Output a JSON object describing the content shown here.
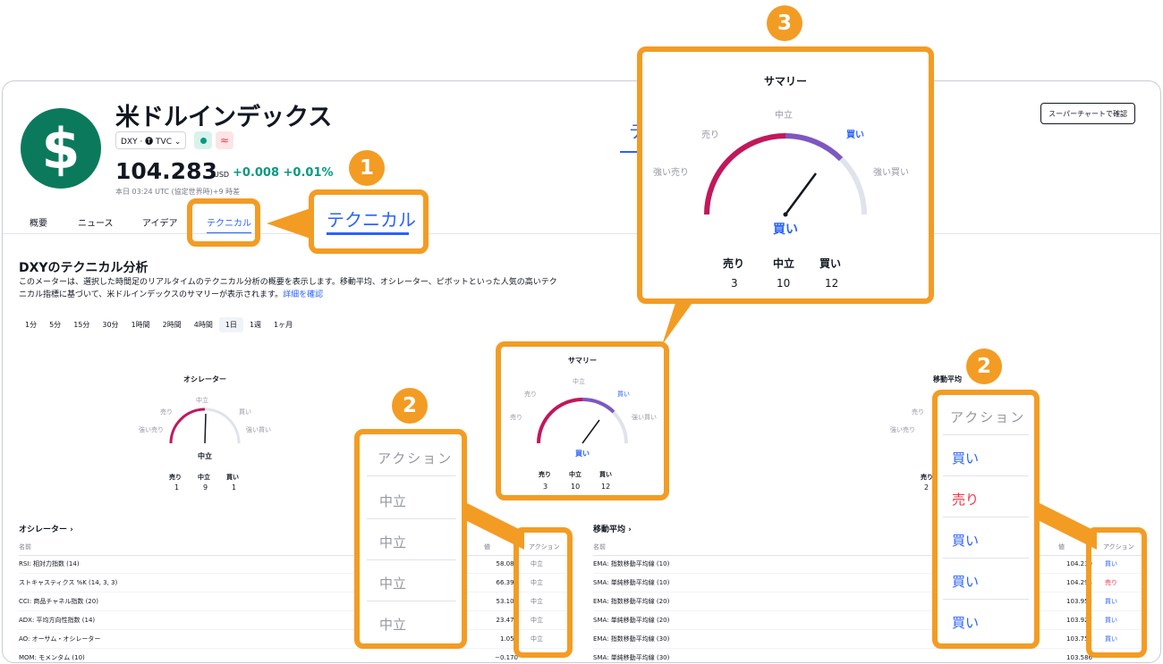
{
  "header": {
    "logo_symbol": "$",
    "title": "米ドルインデックス",
    "symbol_pill": "DXY · 🅣 TVC ⌄",
    "price": "104.283",
    "currency": "USD",
    "change": "+0.008 +0.01%",
    "time_note": "本日 03:24 UTC (協定世界時)+9 時差",
    "super_chart_button": "スーパーチャートで確認",
    "partial_tab": "テ"
  },
  "tabs": [
    "概要",
    "ニュース",
    "アイデア",
    "テクニカル"
  ],
  "section": {
    "heading": "DXYのテクニカル分析",
    "desc": "このメーターは、選択した時間足のリアルタイムのテクニカル分析の概要を表示します。移動平均、オシレーター、ピボットといった人気の高いテクニカル指標に基づいて、米ドルインデックスのサマリーが表示されます。",
    "link": "詳細を確認"
  },
  "timeframes": [
    "1分",
    "5分",
    "15分",
    "30分",
    "1時間",
    "2時間",
    "4時間",
    "1日",
    "1週",
    "1ヶ月"
  ],
  "timeframe_selected": "1日",
  "gauge_labels": {
    "neutral": "中立",
    "sell": "売り",
    "buy": "買い",
    "strong_sell": "強い売り",
    "strong_buy": "強い買い"
  },
  "oscillator_gauge": {
    "title": "オシレーター",
    "result": "中立",
    "sell_label": "売り",
    "neutral_label": "中立",
    "buy_label": "買い",
    "sell": "1",
    "neutral": "9",
    "buy": "1"
  },
  "summary_gauge": {
    "title": "サマリー",
    "result": "買い",
    "sell_label": "売り",
    "neutral_label": "中立",
    "buy_label": "買い",
    "sell": "3",
    "neutral": "10",
    "buy": "12"
  },
  "ma_gauge": {
    "title": "移動平均",
    "neutral_count_partial": "2"
  },
  "oscillator_table": {
    "heading": "オシレーター ›",
    "col_name": "名前",
    "col_value": "値",
    "col_action": "アクション",
    "rows": [
      {
        "name": "RSI: 相対力指数 (14)",
        "value": "58.086",
        "action": "中立"
      },
      {
        "name": "ストキャスティクス %K (14, 3, 3)",
        "value": "66.394",
        "action": "中立"
      },
      {
        "name": "CCI: 商品チャネル指数 (20)",
        "value": "53.104",
        "action": "中立"
      },
      {
        "name": "ADX: 平均方向性指数 (14)",
        "value": "23.472",
        "action": "中立"
      },
      {
        "name": "AO: オーサム・オシレーター",
        "value": "1.054",
        "action": "中立"
      },
      {
        "name": "MOM: モメンタム (10)",
        "value": "−0.170",
        "action": ""
      }
    ]
  },
  "ma_table": {
    "heading": "移動平均 ›",
    "col_name": "名前",
    "col_value": "値",
    "col_action": "アクション",
    "rows": [
      {
        "name": "EMA: 指数移動平均線 (10)",
        "value": "104.239",
        "action": "買い"
      },
      {
        "name": "SMA: 単純移動平均線 (10)",
        "value": "104.294",
        "action": "売り"
      },
      {
        "name": "EMA: 指数移動平均線 (20)",
        "value": "103.952",
        "action": "買い"
      },
      {
        "name": "SMA: 単純移動平均線 (20)",
        "value": "103.927",
        "action": "買い"
      },
      {
        "name": "EMA: 指数移動平均線 (30)",
        "value": "103.752",
        "action": "買い"
      },
      {
        "name": "SMA: 単純移動平均線 (30)",
        "value": "103.586",
        "action": ""
      }
    ]
  },
  "callouts": {
    "badge1": "1",
    "badge2": "2",
    "badge3": "3",
    "tab_zoom": "テクニカル",
    "action_zoom_title": "アクション",
    "osc_zoom_actions": [
      "中立",
      "中立",
      "中立",
      "中立"
    ],
    "ma_zoom_actions": [
      "買い",
      "売り",
      "買い",
      "買い",
      "買い"
    ]
  },
  "colors": {
    "accent": "#2962ff",
    "orange": "#f39c24",
    "sell": "#f23645",
    "positive": "#089981"
  }
}
